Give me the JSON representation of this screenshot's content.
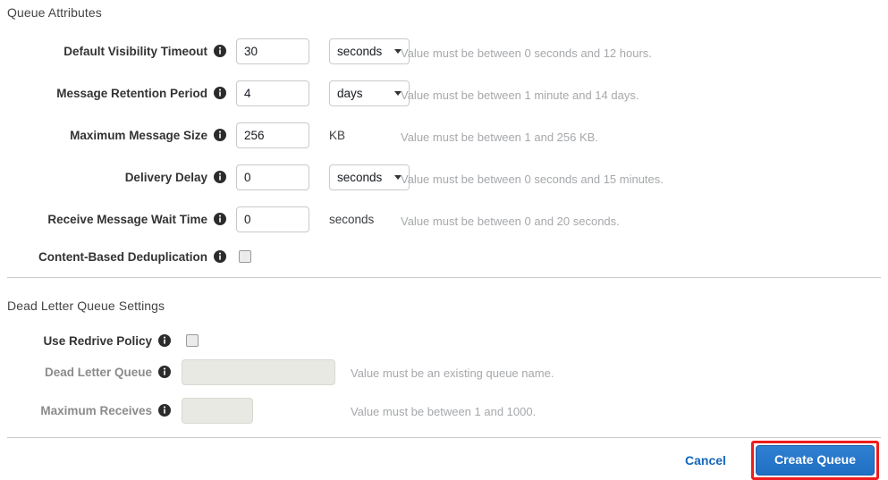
{
  "sections": {
    "queue_attributes_heading": "Queue Attributes",
    "dead_letter_queue_heading": "Dead Letter Queue Settings"
  },
  "queue_attributes": {
    "rows": [
      {
        "label": "Default Visibility Timeout",
        "value": "30",
        "unit_select": "seconds",
        "hint": "Value must be between 0 seconds and 12 hours."
      },
      {
        "label": "Message Retention Period",
        "value": "4",
        "unit_select": "days",
        "hint": "Value must be between 1 minute and 14 days."
      },
      {
        "label": "Maximum Message Size",
        "value": "256",
        "unit_text": "KB",
        "hint": "Value must be between 1 and 256 KB."
      },
      {
        "label": "Delivery Delay",
        "value": "0",
        "unit_select": "seconds",
        "hint": "Value must be between 0 seconds and 15 minutes."
      },
      {
        "label": "Receive Message Wait Time",
        "value": "0",
        "unit_text": "seconds",
        "hint": "Value must be between 0 and 20 seconds."
      },
      {
        "label": "Content-Based Deduplication",
        "checkbox_checked": "false"
      }
    ]
  },
  "dead_letter_queue": {
    "rows": [
      {
        "label": "Use Redrive Policy",
        "checkbox_checked": "false"
      },
      {
        "label": "Dead Letter Queue",
        "value": "",
        "placeholder": "",
        "hint": "Value must be an existing queue name."
      },
      {
        "label": "Maximum Receives",
        "value": "",
        "placeholder": "",
        "hint": "Value must be between 1 and 1000."
      }
    ]
  },
  "footer": {
    "cancel_label": "Cancel",
    "create_label": "Create Queue"
  },
  "colors": {
    "primary_button": "#2f7fd1",
    "link": "#1166bb",
    "highlight_border": "#ee1c1c",
    "hint_text": "#a6a8ab",
    "disabled_field": "#e9e9e3"
  },
  "icons": {
    "info": "info-icon",
    "caret": "chevron-down-icon"
  }
}
